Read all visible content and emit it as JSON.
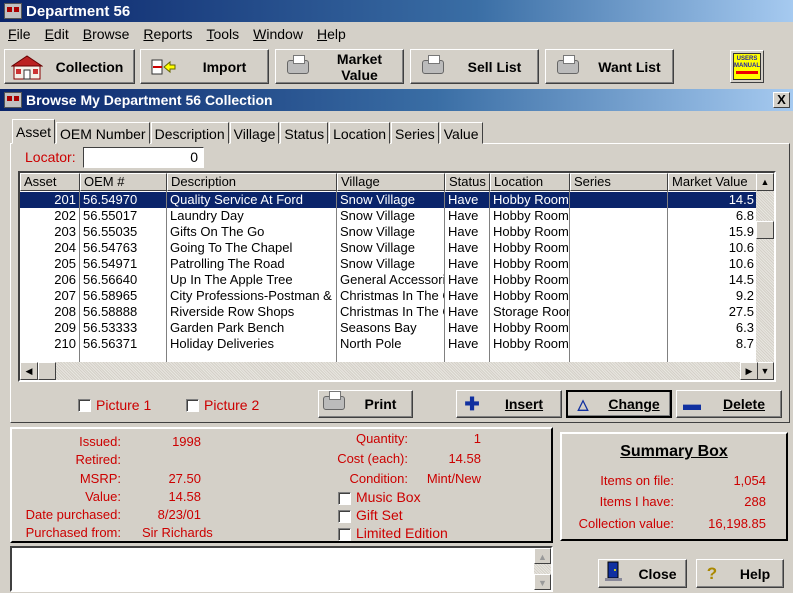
{
  "app": {
    "title": "Department 56"
  },
  "menu": [
    {
      "label": "File",
      "u": "F",
      "rest": "ile"
    },
    {
      "label": "Edit",
      "u": "E",
      "rest": "dit"
    },
    {
      "label": "Browse",
      "u": "B",
      "rest": "rowse"
    },
    {
      "label": "Reports",
      "u": "R",
      "rest": "eports"
    },
    {
      "label": "Tools",
      "u": "T",
      "rest": "ools"
    },
    {
      "label": "Window",
      "u": "W",
      "rest": "indow"
    },
    {
      "label": "Help",
      "u": "H",
      "rest": "elp"
    }
  ],
  "toolbar": {
    "collection": "Collection",
    "import": "Import",
    "market_value_1": "Market",
    "market_value_2": "Value",
    "sell_list": "Sell List",
    "want_list": "Want List",
    "manual_1": "USERS",
    "manual_2": "MANUAL"
  },
  "window": {
    "title": "Browse My Department 56 Collection",
    "close": "X"
  },
  "tabs": [
    "Asset",
    "OEM Number",
    "Description",
    "Village",
    "Status",
    "Location",
    "Series",
    "Value"
  ],
  "locator": {
    "label": "Locator:",
    "value": "0"
  },
  "grid": {
    "columns": [
      "Asset",
      "OEM #",
      "Description",
      "Village",
      "Status",
      "Location",
      "Series",
      "Market Value"
    ],
    "rows": [
      [
        "201",
        "56.54970",
        "Quality Service At Ford",
        "Snow Village",
        "Have",
        "Hobby Room",
        "",
        "14.5"
      ],
      [
        "202",
        "56.55017",
        "Laundry Day",
        "Snow Village",
        "Have",
        "Hobby Room",
        "",
        "6.8"
      ],
      [
        "203",
        "56.55035",
        "Gifts On The Go",
        "Snow Village",
        "Have",
        "Hobby Room",
        "",
        "15.9"
      ],
      [
        "204",
        "56.54763",
        "Going To The Chapel",
        "Snow Village",
        "Have",
        "Hobby Room",
        "",
        "10.6"
      ],
      [
        "205",
        "56.54971",
        "Patrolling The Road",
        "Snow Village",
        "Have",
        "Hobby Room",
        "",
        "10.6"
      ],
      [
        "206",
        "56.56640",
        "Up In The Apple Tree",
        "General Accessories",
        "Have",
        "Hobby Room",
        "",
        "14.5"
      ],
      [
        "207",
        "56.58965",
        "City Professions-Postman &",
        "Christmas In The City",
        "Have",
        "Hobby Room",
        "",
        "9.2"
      ],
      [
        "208",
        "56.58888",
        "Riverside Row Shops",
        "Christmas In The City",
        "Have",
        "Storage Room",
        "",
        "27.5"
      ],
      [
        "209",
        "56.53333",
        "Garden Park Bench",
        "Seasons Bay",
        "Have",
        "Hobby Room",
        "",
        "6.3"
      ],
      [
        "210",
        "56.56371",
        "Holiday Deliveries",
        "North Pole",
        "Have",
        "Hobby Room",
        "",
        "8.7"
      ]
    ]
  },
  "actions": {
    "picture1": "Picture  1",
    "picture2": "Picture 2",
    "print": "Print",
    "insert": "Insert",
    "change": "Change",
    "delete": "Delete"
  },
  "details": {
    "issued_label": "Issued:",
    "issued": "1998",
    "retired_label": "Retired:",
    "retired": "",
    "msrp_label": "MSRP:",
    "msrp": "27.50",
    "value_label": "Value:",
    "value": "14.58",
    "date_label": "Date purchased:",
    "date": "8/23/01",
    "from_label": "Purchased from:",
    "from": "Sir Richards",
    "qty_label": "Quantity:",
    "qty": "1",
    "cost_label": "Cost (each):",
    "cost": "14.58",
    "cond_label": "Condition:",
    "cond": "Mint/New",
    "music_box": "Music Box",
    "gift_set": "Gift Set",
    "limited": "Limited Edition"
  },
  "summary": {
    "title": "Summary Box",
    "on_file_label": "Items on file:",
    "on_file": "1,054",
    "have_label": "Items I have:",
    "have": "288",
    "value_label": "Collection value:",
    "value": "16,198.85"
  },
  "footer": {
    "close": "Close",
    "help": "Help"
  }
}
